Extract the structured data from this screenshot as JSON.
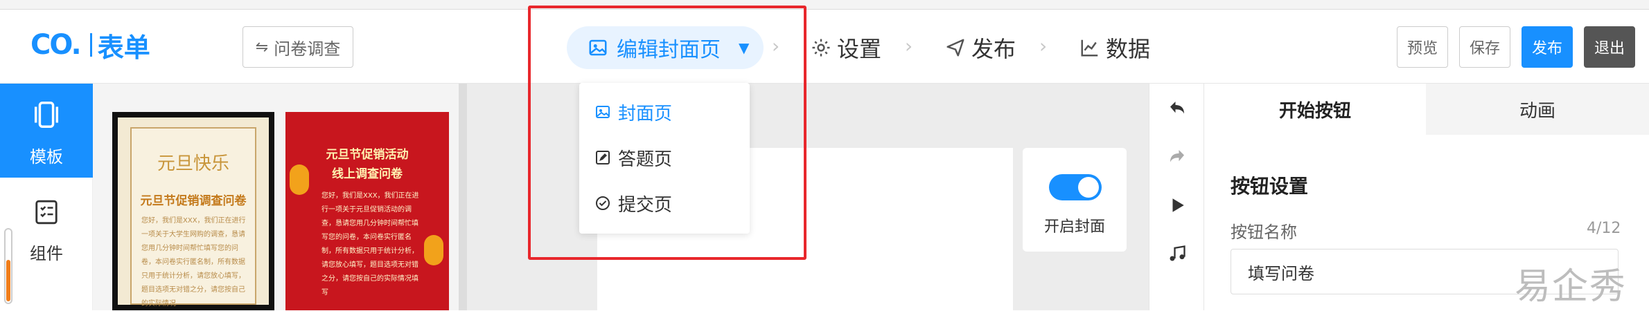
{
  "colors": {
    "accent": "#1890ff",
    "highlight_box": "#e8272c",
    "dark_button": "#555555"
  },
  "header": {
    "logo_mark": "CO.",
    "logo_text": "表单",
    "survey_type_button": "问卷调查",
    "steps": [
      {
        "label": "编辑封面页",
        "icon": "image-icon",
        "active": true
      },
      {
        "label": "设置",
        "icon": "gear-icon",
        "active": false
      },
      {
        "label": "发布",
        "icon": "send-icon",
        "active": false
      },
      {
        "label": "数据",
        "icon": "line-chart-icon",
        "active": false
      }
    ],
    "buttons": {
      "preview": "预览",
      "save": "保存",
      "publish": "发布",
      "exit": "退出"
    }
  },
  "dropdown": {
    "items": [
      {
        "label": "封面页",
        "icon": "image-icon",
        "active": true
      },
      {
        "label": "答题页",
        "icon": "edit-icon",
        "active": false
      },
      {
        "label": "提交页",
        "icon": "check-circle-icon",
        "active": false
      }
    ]
  },
  "sidebar": {
    "tabs": [
      {
        "label": "模板",
        "icon": "template-icon",
        "active": true
      },
      {
        "label": "组件",
        "icon": "checklist-icon",
        "active": false
      }
    ]
  },
  "templates": [
    {
      "headline": "元旦快乐",
      "title": "元旦节促销调查问卷",
      "body": "您好，我们是XXX，我们正在进行一项关于大学生网购的调查，恳请您用几分钟时间帮忙填写您的问卷，本问卷实行匿名制，所有数据只用于统计分析，请您放心填写，题目选项无对错之分，请您按自己的实际情况"
    },
    {
      "title_line1": "元旦节促销活动",
      "title_line2": "线上调查问卷",
      "body": "您好，我们是XXX，我们正在进行一项关于元旦促销活动的调查，恳请您用几分钟时间帮忙填写您的问卷，本问卷实行匿名制，所有数据只用于统计分析，请您放心填写，题目选项无对错之分，请您按自己的实际情况填写"
    }
  ],
  "canvas": {
    "cover_toggle_label": "开启封面",
    "cover_enabled": true
  },
  "toolbar": {
    "icons": [
      "undo-icon",
      "redo-icon",
      "play-icon",
      "music-icon"
    ]
  },
  "right_panel": {
    "tabs": [
      {
        "label": "开始按钮",
        "active": true
      },
      {
        "label": "动画",
        "active": false
      }
    ],
    "section_title": "按钮设置",
    "button_name_label": "按钮名称",
    "button_name_count": "4/12",
    "button_name_value": "填写问卷"
  },
  "watermark": "易企秀"
}
